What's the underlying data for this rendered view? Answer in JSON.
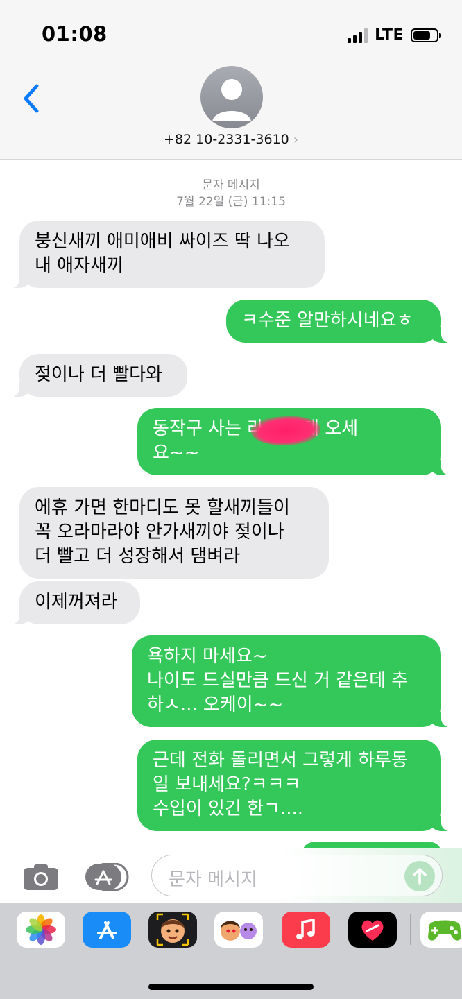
{
  "status_bar": {
    "time": "01:08",
    "network": "LTE"
  },
  "header": {
    "contact": "+82 10-2331-3610"
  },
  "thread": {
    "service": "문자 메시지",
    "timestamp": "7월 22일 (금) 11:15",
    "messages": [
      {
        "from": "them",
        "lines": [
          "붕신새끼 애미애비 싸이즈 딱 나오",
          "내 애자새끼"
        ]
      },
      {
        "from": "me",
        "lines": [
          "ㅋ수준 알만하시네요ㅎ"
        ]
      },
      {
        "from": "them",
        "lines": [
          "젖이나 더 빨다와"
        ]
      },
      {
        "from": "me",
        "lines": [
          "동작구 사는             라 하는데 오세",
          "요~~"
        ]
      },
      {
        "from": "them",
        "lines": [
          "에휴 가면 한마디도 못 할새끼들이",
          "꼭 오라마라야 안가새끼야 젖이나",
          "더 빨고 더 성장해서 댐벼라"
        ]
      },
      {
        "from": "them",
        "lines": [
          "이제꺼져라"
        ]
      },
      {
        "from": "me",
        "lines": [
          "욕하지 마세요~",
          "나이도 드실만큼 드신 거 같은데 추",
          "하ㅅ... 오케이~~"
        ]
      },
      {
        "from": "me",
        "lines": [
          "근데 전화 돌리면서 그렇게 하루동",
          "일 보내세요?ㅋㅋㅋ",
          "수입이 있긴 한ㄱ...."
        ]
      }
    ]
  },
  "composer": {
    "placeholder": "문자 메시지"
  },
  "app_drawer": {
    "apps": [
      "photos-icon",
      "app-store-icon",
      "memoji-icon",
      "animoji-icon",
      "music-icon",
      "digital-touch-icon",
      "game-icon"
    ]
  },
  "colors": {
    "outgoing": "#34c759",
    "incoming": "#e9e9eb",
    "accent": "#007aff"
  }
}
